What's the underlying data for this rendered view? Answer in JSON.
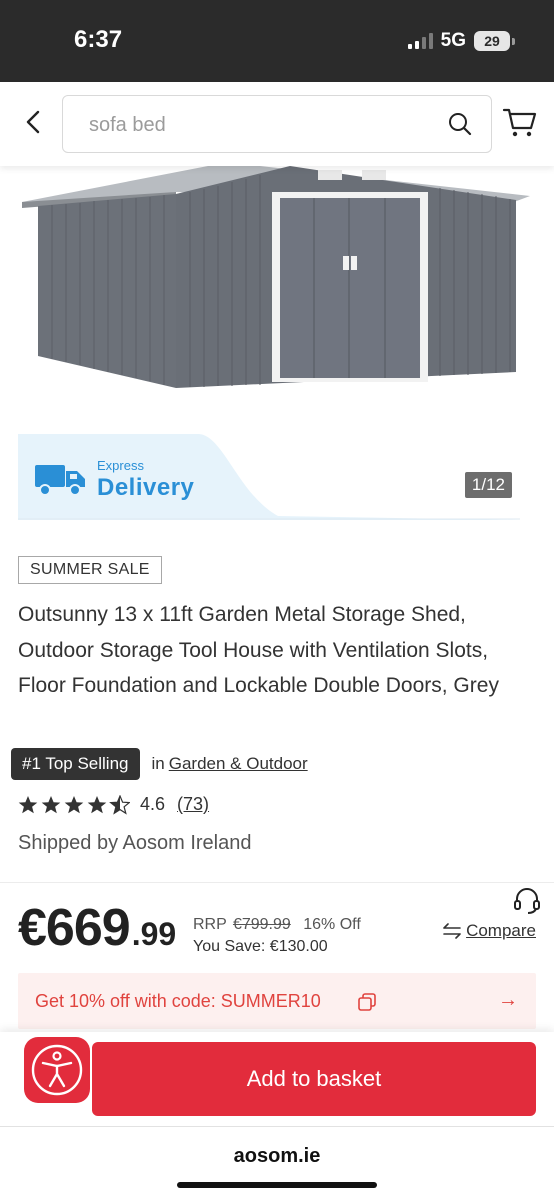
{
  "status_bar": {
    "time": "6:37",
    "network": "5G",
    "battery": "29"
  },
  "search": {
    "placeholder": "sofa bed"
  },
  "gallery": {
    "express_small": "Express",
    "express_big": "Delivery",
    "counter": "1/12"
  },
  "product": {
    "badge": "SUMMER SALE",
    "title": "Outsunny 13 x 11ft Garden Metal Storage Shed, Outdoor Storage Tool House with Ventilation Slots, Floor Foundation and Lockable Double Doors, Grey",
    "top_selling": "#1 Top Selling",
    "in_label": "in",
    "category": "Garden & Outdoor",
    "rating_value": "4.6",
    "rating_count": "(73)",
    "rating_stars": 4.5,
    "shipped_by": "Shipped by Aosom Ireland"
  },
  "price": {
    "whole": "€669",
    "cents": ".99",
    "rrp_label": "RRP",
    "rrp_value": "€799.99",
    "off": "16% Off",
    "you_save": "You Save: €130.00",
    "compare": "Compare"
  },
  "promo": {
    "text": "Get 10% off with code: SUMMER10",
    "arrow": "→"
  },
  "actions": {
    "add_to_basket": "Add to basket"
  },
  "browser": {
    "url": "aosom.ie"
  },
  "colors": {
    "accent_red": "#e22c3c",
    "express_blue": "#2a8fd6",
    "promo_bg": "#fdf0ef"
  }
}
